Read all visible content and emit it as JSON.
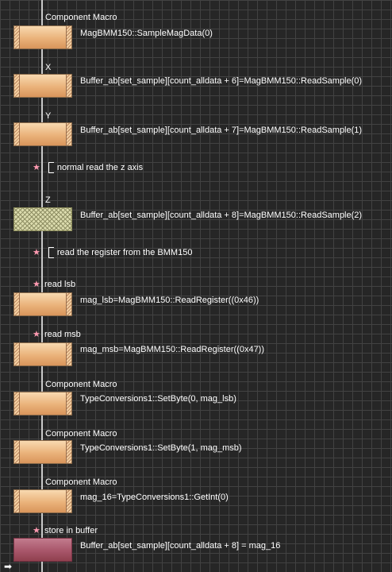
{
  "macro_label": "Component Macro",
  "steps": [
    {
      "label": "Component Macro",
      "code": "MagBMM150::SampleMagData(0)"
    },
    {
      "label": "X",
      "code": "Buffer_ab[set_sample][count_alldata + 6]=MagBMM150::ReadSample(0)"
    },
    {
      "label": "Y",
      "code": "Buffer_ab[set_sample][count_alldata + 7]=MagBMM150::ReadSample(1)"
    },
    {
      "comment": "normal read the z axis"
    },
    {
      "label": "Z",
      "code": "Buffer_ab[set_sample][count_alldata + 8]=MagBMM150::ReadSample(2)",
      "state": "disabled"
    },
    {
      "comment": "read the register from the BMM150"
    },
    {
      "label": "read lsb",
      "code": "mag_lsb=MagBMM150::ReadRegister((0x46))"
    },
    {
      "label": "read msb",
      "code": "mag_msb=MagBMM150::ReadRegister((0x47))"
    },
    {
      "label": "Component Macro",
      "code": "TypeConversions1::SetByte(0, mag_lsb)"
    },
    {
      "label": "Component Macro",
      "code": "TypeConversions1::SetByte(1, mag_msb)"
    },
    {
      "label": "Component Macro",
      "code": "mag_16=TypeConversions1::GetInt(0)"
    },
    {
      "label": "store in buffer",
      "code": "Buffer_ab[set_sample][count_alldata + 8] = mag_16",
      "state": "pink"
    }
  ],
  "colors": {
    "background": "#262626",
    "grid": "#424242",
    "block_orange": "#eab27a",
    "block_disabled": "#dcdcae",
    "block_pink": "#a8566a",
    "comment_star": "#ff9ab1"
  },
  "icons": [
    "comment-star-icon",
    "entry-arrow-icon"
  ]
}
